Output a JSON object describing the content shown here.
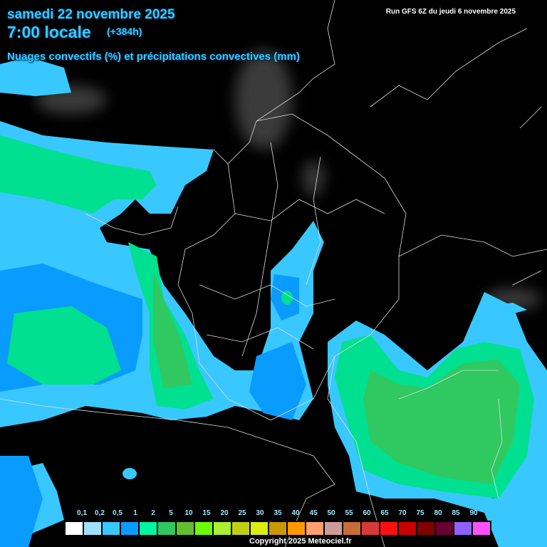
{
  "header": {
    "date": "samedi 22 novembre 2025",
    "time": "7:00 locale",
    "lead": "(+384h)",
    "parameter": "Nuages convectifs (%) et précipitations convectives (mm)",
    "run": "Run GFS 6Z du jeudi 6 novembre 2025"
  },
  "legend": {
    "labels": [
      "0,1",
      "0,2",
      "0,5",
      "1",
      "2",
      "5",
      "10",
      "15",
      "20",
      "25",
      "30",
      "35",
      "40",
      "45",
      "50",
      "55",
      "60",
      "65",
      "70",
      "75",
      "80",
      "85",
      "90"
    ],
    "colors": [
      "#ffffff",
      "#a0e0ff",
      "#38c8ff",
      "#0a9bff",
      "#00f5a0",
      "#30c860",
      "#60c030",
      "#6cff00",
      "#a8f030",
      "#c0d010",
      "#dcec10",
      "#c89800",
      "#ff9800",
      "#ffa070",
      "#cc9c9c",
      "#c86c38",
      "#d83838",
      "#ff1010",
      "#c80000",
      "#800000",
      "#680030",
      "#9060ff",
      "#ff50ff"
    ]
  },
  "footer": {
    "copyright": "Copyright 2025 Meteociel.fr"
  }
}
